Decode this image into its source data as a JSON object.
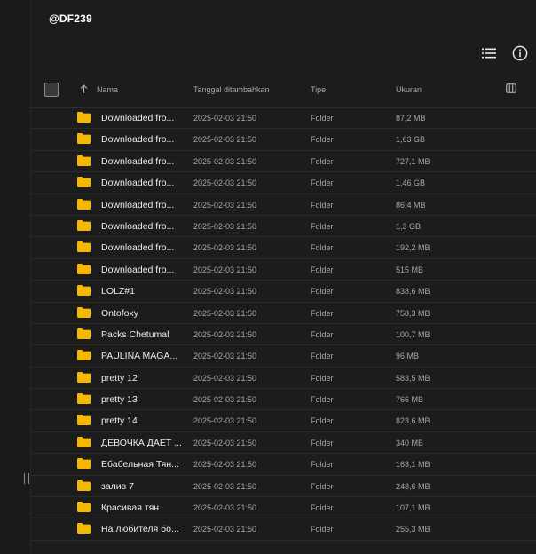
{
  "header": {
    "title": "@DF239"
  },
  "table": {
    "columns": {
      "name": "Nama",
      "date": "Tanggal ditambahkan",
      "type": "Tipe",
      "size": "Ukuran"
    },
    "rows": [
      {
        "name": "Downloaded fro...",
        "date": "2025-02-03 21:50",
        "type": "Folder",
        "size": "87,2 MB"
      },
      {
        "name": "Downloaded fro...",
        "date": "2025-02-03 21:50",
        "type": "Folder",
        "size": "1,63 GB"
      },
      {
        "name": "Downloaded fro...",
        "date": "2025-02-03 21:50",
        "type": "Folder",
        "size": "727,1 MB"
      },
      {
        "name": "Downloaded fro...",
        "date": "2025-02-03 21:50",
        "type": "Folder",
        "size": "1,46 GB"
      },
      {
        "name": "Downloaded fro...",
        "date": "2025-02-03 21:50",
        "type": "Folder",
        "size": "86,4 MB"
      },
      {
        "name": "Downloaded fro...",
        "date": "2025-02-03 21:50",
        "type": "Folder",
        "size": "1,3 GB"
      },
      {
        "name": "Downloaded fro...",
        "date": "2025-02-03 21:50",
        "type": "Folder",
        "size": "192,2 MB"
      },
      {
        "name": "Downloaded fro...",
        "date": "2025-02-03 21:50",
        "type": "Folder",
        "size": "515 MB"
      },
      {
        "name": "LOLZ#1",
        "date": "2025-02-03 21:50",
        "type": "Folder",
        "size": "838,6 MB"
      },
      {
        "name": "Ontofoxy",
        "date": "2025-02-03 21:50",
        "type": "Folder",
        "size": "758,3 MB"
      },
      {
        "name": "Packs Chetumal",
        "date": "2025-02-03 21:50",
        "type": "Folder",
        "size": "100,7 MB"
      },
      {
        "name": "PAULINA MAGA...",
        "date": "2025-02-03 21:50",
        "type": "Folder",
        "size": "96 MB"
      },
      {
        "name": "pretty 12",
        "date": "2025-02-03 21:50",
        "type": "Folder",
        "size": "583,5 MB"
      },
      {
        "name": "pretty 13",
        "date": "2025-02-03 21:50",
        "type": "Folder",
        "size": "766 MB"
      },
      {
        "name": "pretty 14",
        "date": "2025-02-03 21:50",
        "type": "Folder",
        "size": "823,6 MB"
      },
      {
        "name": "ДЕВОЧКА ДАЕТ ...",
        "date": "2025-02-03 21:50",
        "type": "Folder",
        "size": "340 MB"
      },
      {
        "name": "Ебабельная Тян...",
        "date": "2025-02-03 21:50",
        "type": "Folder",
        "size": "163,1 MB"
      },
      {
        "name": "залив 7",
        "date": "2025-02-03 21:50",
        "type": "Folder",
        "size": "248,6 MB"
      },
      {
        "name": "Красивая тян",
        "date": "2025-02-03 21:50",
        "type": "Folder",
        "size": "107,1 MB"
      },
      {
        "name": "На любителя бо...",
        "date": "2025-02-03 21:50",
        "type": "Folder",
        "size": "255,3 MB"
      }
    ]
  },
  "icons": {
    "folder": "folder-icon",
    "list_view": "list-view-icon",
    "info": "info-icon",
    "sort": "sort-arrow-up-icon",
    "columns": "column-settings-icon"
  },
  "colors": {
    "folder": "#f5b800",
    "background": "#1c1c1c",
    "text_primary": "#ececec",
    "text_secondary": "#a8a8a8"
  }
}
